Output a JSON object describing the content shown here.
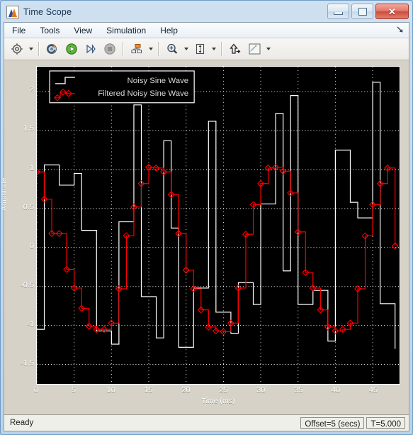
{
  "window": {
    "title": "Time Scope",
    "app_icon": "matlab-icon",
    "controls": {
      "minimize": "minimize-icon",
      "maximize": "maximize-icon",
      "close": "✕"
    }
  },
  "menubar": {
    "items": [
      "File",
      "Tools",
      "View",
      "Simulation",
      "Help"
    ],
    "undock": "undock-arrow-icon"
  },
  "toolbar": {
    "groups": [
      {
        "buttons": [
          {
            "icon": "gear-icon",
            "caret": true
          }
        ]
      },
      {
        "buttons": [
          {
            "icon": "run-back-icon",
            "caret": false
          },
          {
            "icon": "play-icon",
            "caret": false
          },
          {
            "icon": "step-forward-icon",
            "caret": false
          },
          {
            "icon": "stop-icon",
            "caret": false
          }
        ]
      },
      {
        "buttons": [
          {
            "icon": "simulink-model-icon",
            "caret": true
          }
        ]
      },
      {
        "buttons": [
          {
            "icon": "zoom-in-icon",
            "caret": true
          },
          {
            "icon": "autoscale-icon",
            "caret": true
          }
        ]
      },
      {
        "buttons": [
          {
            "icon": "scale-axes-icon",
            "caret": false
          },
          {
            "icon": "measurements-icon",
            "caret": true
          }
        ]
      }
    ]
  },
  "statusbar": {
    "message": "Ready",
    "offset": "Offset=5 (secs)",
    "time": "T=5.000"
  },
  "chart_data": {
    "type": "line",
    "title": "",
    "xlabel": "Time (ms)",
    "ylabel": "Amplitude",
    "xlim": [
      0,
      48.6
    ],
    "ylim": [
      -1.75,
      2.32
    ],
    "xticks": [
      0,
      5,
      10,
      15,
      20,
      25,
      30,
      35,
      40,
      45
    ],
    "yticks": [
      2,
      1.5,
      1,
      0.5,
      0,
      -0.5,
      -1,
      -1.5
    ],
    "grid": true,
    "background": "#000000",
    "legend": {
      "position": "top-left",
      "entries": [
        {
          "label": "Noisy Sine Wave",
          "color": "#FFFFFF",
          "style": "stairs"
        },
        {
          "label": "Filtered Noisy Sine Wave",
          "color": "#FF0000",
          "style": "stairs-markers"
        }
      ]
    },
    "step": 1.0,
    "series": [
      {
        "name": "Noisy Sine Wave",
        "color": "#FFFFFF",
        "marker": "none",
        "x": [
          0,
          1,
          2,
          3,
          4,
          5,
          6,
          7,
          8,
          9,
          10,
          11,
          12,
          13,
          14,
          15,
          16,
          17,
          18,
          19,
          20,
          21,
          22,
          23,
          24,
          25,
          26,
          27,
          28,
          29,
          30,
          31,
          32,
          33,
          34,
          35,
          36,
          37,
          38,
          39,
          40,
          41,
          42,
          43,
          44,
          45,
          46,
          47,
          48
        ],
        "values": [
          -1.05,
          1.06,
          1.06,
          0.8,
          0.8,
          0.95,
          0.22,
          0.22,
          -1.07,
          -1.07,
          -1.24,
          0.33,
          0.33,
          1.83,
          -0.63,
          -0.63,
          -1.16,
          1.37,
          0.25,
          -1.28,
          -1.28,
          -0.52,
          -0.52,
          1.62,
          -0.83,
          -0.83,
          -1.1,
          -0.45,
          -0.45,
          -0.73,
          0.56,
          0.56,
          1.72,
          -0.3,
          1.95,
          -0.73,
          -0.73,
          -0.55,
          -0.55,
          -1.2,
          1.25,
          1.25,
          0.58,
          0.38,
          0.38,
          2.12,
          -0.72,
          -0.72,
          -1.3
        ]
      },
      {
        "name": "Filtered Noisy Sine Wave",
        "color": "#FF0000",
        "marker": "diamond",
        "x": [
          0,
          1,
          2,
          3,
          4,
          5,
          6,
          7,
          8,
          9,
          10,
          11,
          12,
          13,
          14,
          15,
          16,
          17,
          18,
          19,
          20,
          21,
          22,
          23,
          24,
          25,
          26,
          27,
          28,
          29,
          30,
          31,
          32,
          33,
          34,
          35,
          36,
          37,
          38,
          39,
          40,
          41,
          42,
          43,
          44,
          45,
          46,
          47,
          48
        ],
        "values": [
          0.97,
          0.62,
          0.18,
          0.18,
          -0.28,
          -0.52,
          -0.78,
          -1.01,
          -1.05,
          -1.05,
          -0.97,
          -0.53,
          0.15,
          0.52,
          0.82,
          1.03,
          1.02,
          0.97,
          0.68,
          0.18,
          -0.29,
          -0.53,
          -0.8,
          -1.02,
          -1.07,
          -1.08,
          -0.97,
          -0.52,
          0.17,
          0.55,
          0.82,
          1.02,
          1.03,
          0.98,
          0.7,
          0.2,
          -0.32,
          -0.52,
          -0.8,
          -1.02,
          -1.07,
          -1.05,
          -0.97,
          -0.53,
          0.15,
          0.55,
          0.82,
          1.02,
          0.02
        ]
      }
    ]
  }
}
